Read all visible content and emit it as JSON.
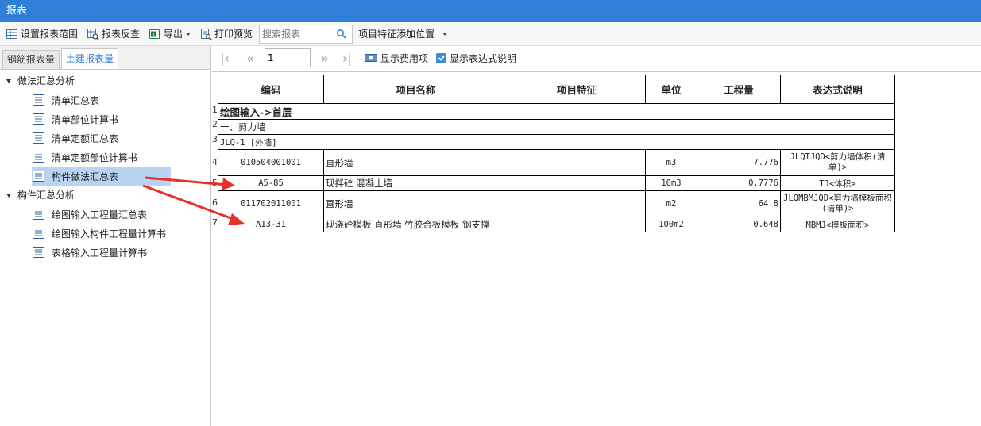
{
  "window": {
    "title": "报表"
  },
  "toolbar": {
    "set_range": "设置报表范围",
    "reverse_check": "报表反查",
    "export": "导出",
    "print_preview": "打印预览",
    "search_placeholder": "搜索报表",
    "feature_position": "项目特征添加位置"
  },
  "tabs": [
    "钢筋报表量",
    "土建报表量"
  ],
  "active_tab": "土建报表量",
  "tree": {
    "group1": {
      "label": "做法汇总分析",
      "items": [
        "清单汇总表",
        "清单部位计算书",
        "清单定额汇总表",
        "清单定额部位计算书",
        "构件做法汇总表"
      ]
    },
    "group2": {
      "label": "构件汇总分析",
      "items": [
        "绘图输入工程量汇总表",
        "绘图输入构件工程量计算书",
        "表格输入工程量计算书"
      ]
    },
    "selected": "构件做法汇总表"
  },
  "nav": {
    "page": "1",
    "show_cost": "显示费用项",
    "show_expr": "显示表达式说明",
    "show_cost_checked": false,
    "show_expr_checked": true
  },
  "report": {
    "headers": [
      "编码",
      "项目名称",
      "项目特征",
      "单位",
      "工程量",
      "表达式说明"
    ],
    "rows": [
      {
        "num": "1",
        "section": "绘图输入->首层",
        "bold": true
      },
      {
        "num": "2",
        "section": "一、剪力墙"
      },
      {
        "num": "3",
        "section": "JLQ-1 [外墙]"
      },
      {
        "num": "4",
        "code": "010504001001",
        "name": "直形墙",
        "feature": "",
        "unit": "m3",
        "qty": "7.776",
        "expr": "JLQTJQD<剪力墙体积(清单)>"
      },
      {
        "num": "5",
        "code": "A5-85",
        "name": "现拌砼 混凝土墙",
        "feature": "",
        "unit": "10m3",
        "qty": "0.7776",
        "expr": "TJ<体积>"
      },
      {
        "num": "6",
        "code": "011702011001",
        "name": "直形墙",
        "feature": "",
        "unit": "m2",
        "qty": "64.8",
        "expr": "JLQMBMJQD<剪力墙模板面积(清单)>"
      },
      {
        "num": "7",
        "code": "A13-31",
        "name": "现浇砼模板 直形墙 竹胶合板模板 钢支撑",
        "feature": "",
        "unit": "100m2",
        "qty": "0.648",
        "expr": "MBMJ<模板面积>"
      }
    ]
  },
  "colors": {
    "titlebar": "#2f7fd8",
    "selection": "#b9d4f2",
    "arrow": "#e8302a"
  }
}
